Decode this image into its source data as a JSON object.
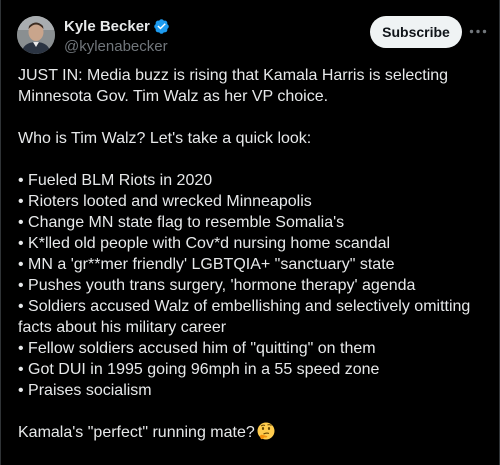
{
  "author": {
    "display_name": "Kyle Becker",
    "handle": "@kylenabecker",
    "verified_icon": "verified-badge-icon",
    "accent_color": "#1d9bf0"
  },
  "subscribe_label": "Subscribe",
  "more_icon": "more-options-icon",
  "tweet": {
    "intro_1": "JUST IN: Media buzz is rising that Kamala Harris is selecting",
    "intro_2": "Minnesota Gov. Tim Walz as her VP choice.",
    "question": "Who is Tim Walz? Let's take a quick look:",
    "bullets": [
      "• Fueled BLM Riots in 2020",
      "• Rioters looted and wrecked Minneapolis",
      "• Change MN state flag to resemble Somalia's",
      "• K*lled old people with Cov*d nursing home scandal",
      "• MN a 'gr**mer friendly' LGBTQIA+ \"sanctuary\" state",
      "• Pushes youth trans surgery, 'hormone therapy' agenda",
      "• Soldiers accused Walz of embellishing and selectively omitting",
      "facts about his military career",
      "• Fellow soldiers accused him of \"quitting\" on them",
      "• Got DUI in 1995 going 96mph in a 55 speed zone",
      "• Praises socialism"
    ],
    "closing": "Kamala's \"perfect\" running mate?",
    "closing_emoji": "thinking-face-emoji"
  }
}
